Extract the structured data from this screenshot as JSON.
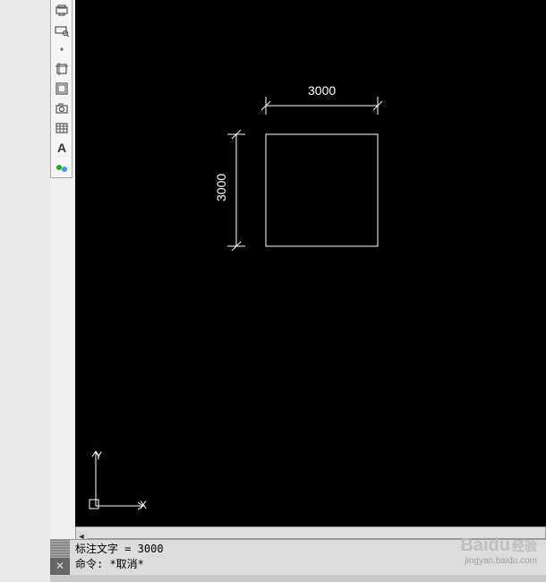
{
  "toolbar": {
    "items": [
      {
        "name": "plot-icon"
      },
      {
        "name": "plot-preview-icon"
      },
      {
        "name": "point-icon"
      },
      {
        "name": "crop-rect-icon"
      },
      {
        "name": "crop-frame-icon"
      },
      {
        "name": "camera-icon"
      },
      {
        "name": "table-icon"
      },
      {
        "name": "text-icon"
      },
      {
        "name": "circles-icon"
      }
    ]
  },
  "drawing": {
    "dim_h": "3000",
    "dim_v": "3000",
    "ucs_x": "X",
    "ucs_y": "Y"
  },
  "command": {
    "line1": "标注文字 = 3000",
    "line2": "命令: *取消*"
  },
  "watermark": {
    "brand": "Baidu",
    "suffix": "经验",
    "url": "jingyan.baidu.com"
  }
}
